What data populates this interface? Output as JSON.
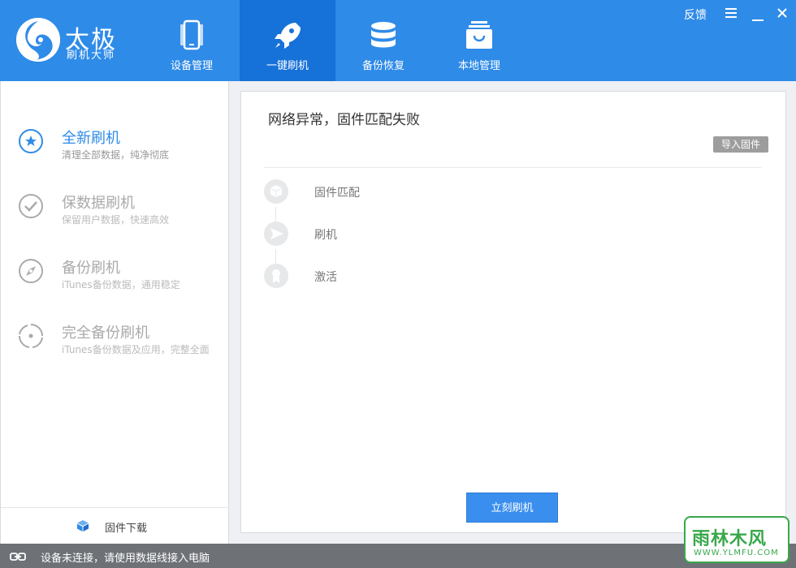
{
  "app": {
    "logo_title": "太极",
    "logo_subtitle": "刷机大师"
  },
  "nav": [
    {
      "label": "设备管理",
      "icon": "phone-icon"
    },
    {
      "label": "一键刷机",
      "icon": "rocket-icon",
      "active": true
    },
    {
      "label": "备份恢复",
      "icon": "database-icon"
    },
    {
      "label": "本地管理",
      "icon": "shopping-bag-icon"
    }
  ],
  "window": {
    "feedback_label": "反馈",
    "menu_icon": "menu-icon",
    "minimize_icon": "minimize-icon",
    "close_icon": "close-icon"
  },
  "modes": [
    {
      "title": "全新刷机",
      "subtitle": "清理全部数据，纯净彻底",
      "icon": "star-circle-icon",
      "active": true
    },
    {
      "title": "保数据刷机",
      "subtitle": "保留用户数据，快速高效",
      "icon": "check-circle-icon"
    },
    {
      "title": "备份刷机",
      "subtitle": "iTunes备份数据，通用稳定",
      "icon": "compass-icon"
    },
    {
      "title": "完全备份刷机",
      "subtitle": "iTunes备份数据及应用，完整全面",
      "icon": "refresh-circle-icon"
    }
  ],
  "firmware_download": {
    "label": "固件下载",
    "icon": "cube-icon"
  },
  "main": {
    "error_title": "网络异常，固件匹配失败",
    "import_label": "导入固件",
    "steps": [
      {
        "label": "固件匹配",
        "icon": "box-icon"
      },
      {
        "label": "刷机",
        "icon": "send-icon"
      },
      {
        "label": "激活",
        "icon": "badge-icon"
      }
    ],
    "flash_button": "立刻刷机"
  },
  "status": {
    "text": "设备未连接，请使用数据线接入电脑",
    "icon": "connection-icon"
  },
  "watermark": {
    "title": "雨林木风",
    "url": "WWW.YLMFU.COM"
  },
  "colors": {
    "accent": "#2f8be8",
    "active_tab": "#1671d8",
    "status_bar": "#6e7277",
    "button": "#3a8fee"
  }
}
